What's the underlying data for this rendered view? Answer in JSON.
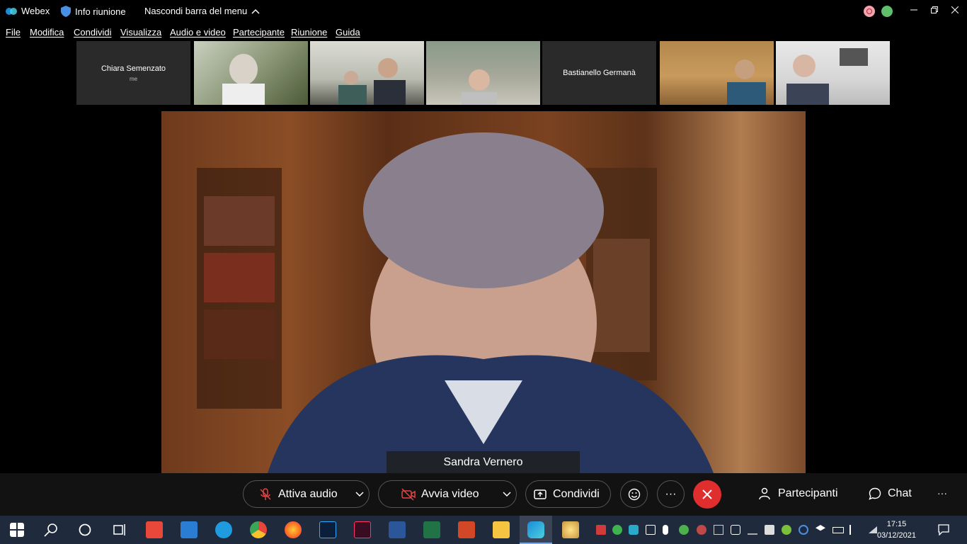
{
  "titlebar": {
    "app_name": "Webex",
    "info_meeting": "Info riunione",
    "hide_menu": "Nascondi barra del menu"
  },
  "menu": {
    "items": [
      "File",
      "Modifica",
      "Condividi",
      "Visualizza",
      "Audio e video",
      "Partecipante",
      "Riunione",
      "Guida"
    ]
  },
  "thumbnails": [
    {
      "name": "Chiara Semenzato",
      "sub": "me"
    },
    {
      "name": "Bastianello Germanà"
    }
  ],
  "main_video": {
    "speaker": "Sandra Vernero"
  },
  "controls": {
    "audio": "Attiva audio",
    "video": "Avvia video",
    "share": "Condividi",
    "participants": "Partecipanti",
    "chat": "Chat",
    "more": "···",
    "ellipsis": "···"
  },
  "taskbar": {
    "time": "17:15",
    "date": "03/12/2021"
  },
  "colors": {
    "end_call": "#e02d2d",
    "taskbar": "#1f2a3c",
    "control_bar": "#121212"
  }
}
